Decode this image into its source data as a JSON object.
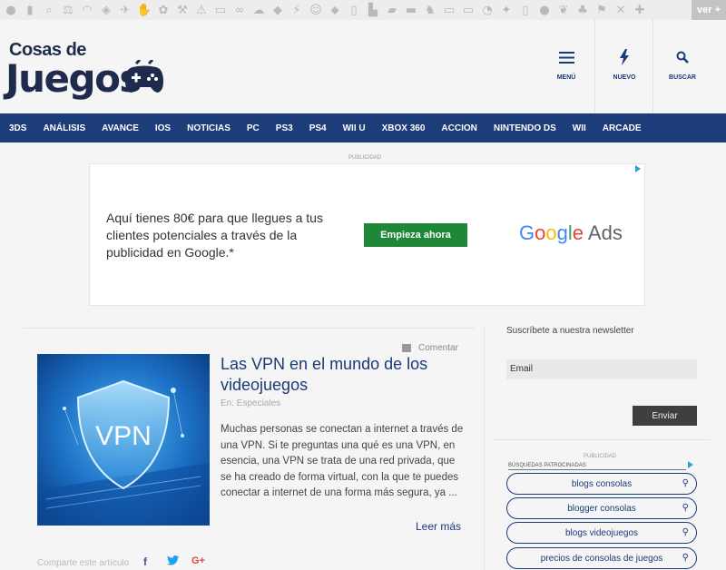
{
  "top_strip": {
    "icons": [
      "apple-icon",
      "book-icon",
      "search-icon",
      "scale-icon",
      "lips-icon",
      "puzzle-icon",
      "plane-icon",
      "hand-icon",
      "gear-icon",
      "tools-icon",
      "bell-icon",
      "gamepad-icon",
      "link-icon",
      "cloud-icon",
      "diamond-icon",
      "bolt-icon",
      "user-icon",
      "tag-icon",
      "bottle-icon",
      "building-icon",
      "bag-icon",
      "car-icon",
      "runner-icon",
      "card-icon",
      "tv-icon",
      "clock-icon",
      "run-icon",
      "phone-icon",
      "apple2-icon",
      "leaf-icon",
      "sport-icon",
      "flag-icon",
      "cross-icon",
      "health-icon"
    ],
    "glyphs": [
      "●",
      "▮",
      "⌕",
      "⚖",
      "◠",
      "◈",
      "✈",
      "✋",
      "✿",
      "⚒",
      "⚠",
      "▭",
      "∞",
      "☁",
      "◆",
      "⚡",
      "☺",
      "⬥",
      "▯",
      "▙",
      "▰",
      "▬",
      "♞",
      "▭",
      "▭",
      "◔",
      "✦",
      "▯",
      "●",
      "❦",
      "♣",
      "⚑",
      "✕",
      "✚"
    ],
    "ver_mas": "ver +"
  },
  "header": {
    "logo_line1": "Cosas de",
    "logo_line2": "Juegos",
    "menu_label": "MENÚ",
    "nuevo_label": "NUEVO",
    "buscar_label": "BUSCAR"
  },
  "nav": {
    "items": [
      "3DS",
      "ANÁLISIS",
      "AVANCE",
      "IOS",
      "NOTICIAS",
      "PC",
      "PS3",
      "PS4",
      "WII U",
      "XBOX 360",
      "ACCION",
      "NINTENDO DS",
      "WII",
      "ARCADE"
    ]
  },
  "ad": {
    "publicidad": "PUBLICIDAD",
    "text": "Aquí tienes 80€ para que llegues a tus clientes potenciales a través de la publicidad en Google.*",
    "button": "Empieza ahora",
    "brand_google": "Google",
    "brand_ads": "Ads"
  },
  "article": {
    "comment_label": "Comentar",
    "title": "Las VPN en el mundo de los videojuegos",
    "category": "En: Especiales",
    "excerpt": "Muchas personas se conectan a internet a través de una VPN. Si te preguntas una qué es una VPN, en esencia, una VPN se trata de una red privada, que se ha creado de forma virtual, con la que te puedes conectar a internet de una forma más segura, ya ...",
    "read_more": "Leer más",
    "share_label": "Comparte este artículo",
    "image_text": "VPN"
  },
  "sidebar": {
    "newsletter_label": "Suscríbete a nuestra newsletter",
    "email_placeholder": "Email",
    "submit_label": "Enviar",
    "publicidad": "PUBLICIDAD",
    "sponsored_title": "BÚSQUEDAS PATROCINADAS",
    "searches": [
      "blogs consolas",
      "blogger consolas",
      "blogs videojuegos",
      "precios de consolas de juegos"
    ]
  },
  "colors": {
    "nav_bg": "#1c3d7a",
    "accent": "#1a3a7a",
    "ad_button": "#1e8838"
  }
}
